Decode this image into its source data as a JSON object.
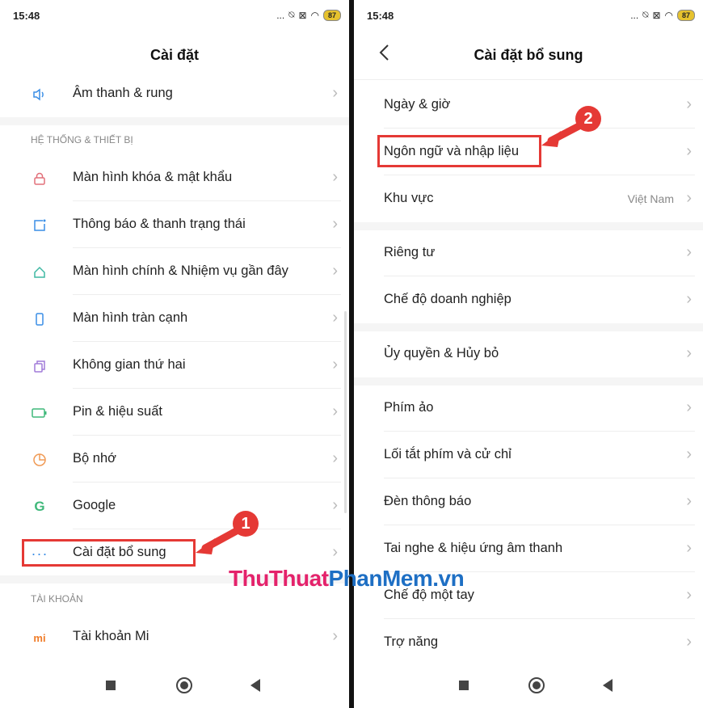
{
  "status": {
    "time": "15:48",
    "dots": "...",
    "battery": "87"
  },
  "left": {
    "title": "Cài đặt",
    "top_item": "Âm thanh & rung",
    "section1": "HỆ THỐNG & THIẾT BỊ",
    "items": [
      {
        "label": "Màn hình khóa & mật khẩu",
        "icon": "lock-icon"
      },
      {
        "label": "Thông báo & thanh trạng thái",
        "icon": "notification-icon"
      },
      {
        "label": "Màn hình chính & Nhiệm vụ gần đây",
        "icon": "home-icon"
      },
      {
        "label": "Màn hình tràn cạnh",
        "icon": "phone-icon"
      },
      {
        "label": "Không gian thứ hai",
        "icon": "second-space-icon"
      },
      {
        "label": "Pin & hiệu suất",
        "icon": "battery-icon"
      },
      {
        "label": "Bộ nhớ",
        "icon": "storage-icon"
      },
      {
        "label": "Google",
        "icon": "google-icon"
      },
      {
        "label": "Cài đặt bổ sung",
        "icon": "more-icon"
      }
    ],
    "section2": "TÀI KHOẢN",
    "account_item": "Tài khoản Mi"
  },
  "right": {
    "title": "Cài đặt bổ sung",
    "group1": [
      {
        "label": "Ngày & giờ",
        "value": ""
      },
      {
        "label": "Ngôn ngữ và nhập liệu",
        "value": ""
      },
      {
        "label": "Khu vực",
        "value": "Việt Nam"
      }
    ],
    "group2": [
      {
        "label": "Riêng tư"
      },
      {
        "label": "Chế độ doanh nghiệp"
      }
    ],
    "group3": [
      {
        "label": "Ủy quyền & Hủy bỏ"
      }
    ],
    "group4": [
      {
        "label": "Phím ảo"
      },
      {
        "label": "Lối tắt phím và cử chỉ"
      },
      {
        "label": "Đèn thông báo"
      },
      {
        "label": "Tai nghe & hiệu ứng âm thanh"
      },
      {
        "label": "Chế độ một tay"
      },
      {
        "label": "Trợ năng"
      }
    ]
  },
  "annotations": {
    "step1": "1",
    "step2": "2",
    "accent": "#e53935"
  },
  "watermark": {
    "part1": "ThuThuat",
    "part2": "PhanMem",
    "part3": ".vn"
  }
}
